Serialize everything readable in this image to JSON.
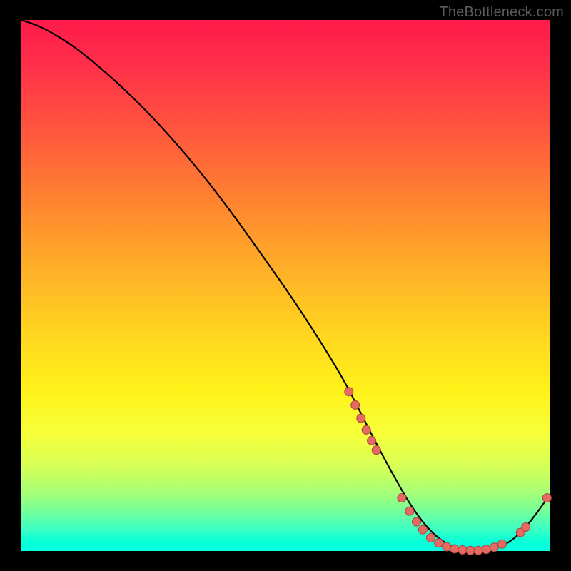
{
  "watermark": "TheBottleneck.com",
  "colors": {
    "page_bg": "#000000",
    "curve": "#000000",
    "dot_fill": "#e46a63",
    "dot_stroke": "#a8423c"
  },
  "chart_data": {
    "type": "line",
    "title": "",
    "xlabel": "",
    "ylabel": "",
    "xlim": [
      0,
      100
    ],
    "ylim": [
      0,
      100
    ],
    "grid": false,
    "legend": false,
    "series": [
      {
        "name": "curve",
        "x": [
          0,
          3,
          6,
          10,
          15,
          20,
          25,
          30,
          35,
          40,
          45,
          50,
          55,
          60,
          63,
          66,
          70,
          74,
          78,
          82,
          86,
          90,
          93,
          96,
          100
        ],
        "y": [
          100,
          99,
          97.5,
          95,
          91,
          86.5,
          81.5,
          76,
          70,
          63.5,
          56.5,
          49.5,
          42,
          34,
          28.5,
          22.5,
          15,
          8,
          3,
          0.5,
          0,
          0.5,
          2,
          5,
          10.5
        ]
      }
    ],
    "dots": [
      {
        "x": 62.0,
        "y": 30.0
      },
      {
        "x": 63.2,
        "y": 27.5
      },
      {
        "x": 64.3,
        "y": 25.0
      },
      {
        "x": 65.3,
        "y": 22.8
      },
      {
        "x": 66.3,
        "y": 20.8
      },
      {
        "x": 67.2,
        "y": 19.0
      },
      {
        "x": 72.0,
        "y": 10.0
      },
      {
        "x": 73.5,
        "y": 7.5
      },
      {
        "x": 74.8,
        "y": 5.5
      },
      {
        "x": 76.0,
        "y": 4.0
      },
      {
        "x": 77.5,
        "y": 2.5
      },
      {
        "x": 79.0,
        "y": 1.5
      },
      {
        "x": 80.5,
        "y": 0.8
      },
      {
        "x": 82.0,
        "y": 0.4
      },
      {
        "x": 83.5,
        "y": 0.2
      },
      {
        "x": 85.0,
        "y": 0.1
      },
      {
        "x": 86.5,
        "y": 0.1
      },
      {
        "x": 88.0,
        "y": 0.3
      },
      {
        "x": 89.5,
        "y": 0.7
      },
      {
        "x": 91.0,
        "y": 1.3
      },
      {
        "x": 94.5,
        "y": 3.5
      },
      {
        "x": 95.5,
        "y": 4.5
      },
      {
        "x": 99.5,
        "y": 10.0
      }
    ]
  }
}
